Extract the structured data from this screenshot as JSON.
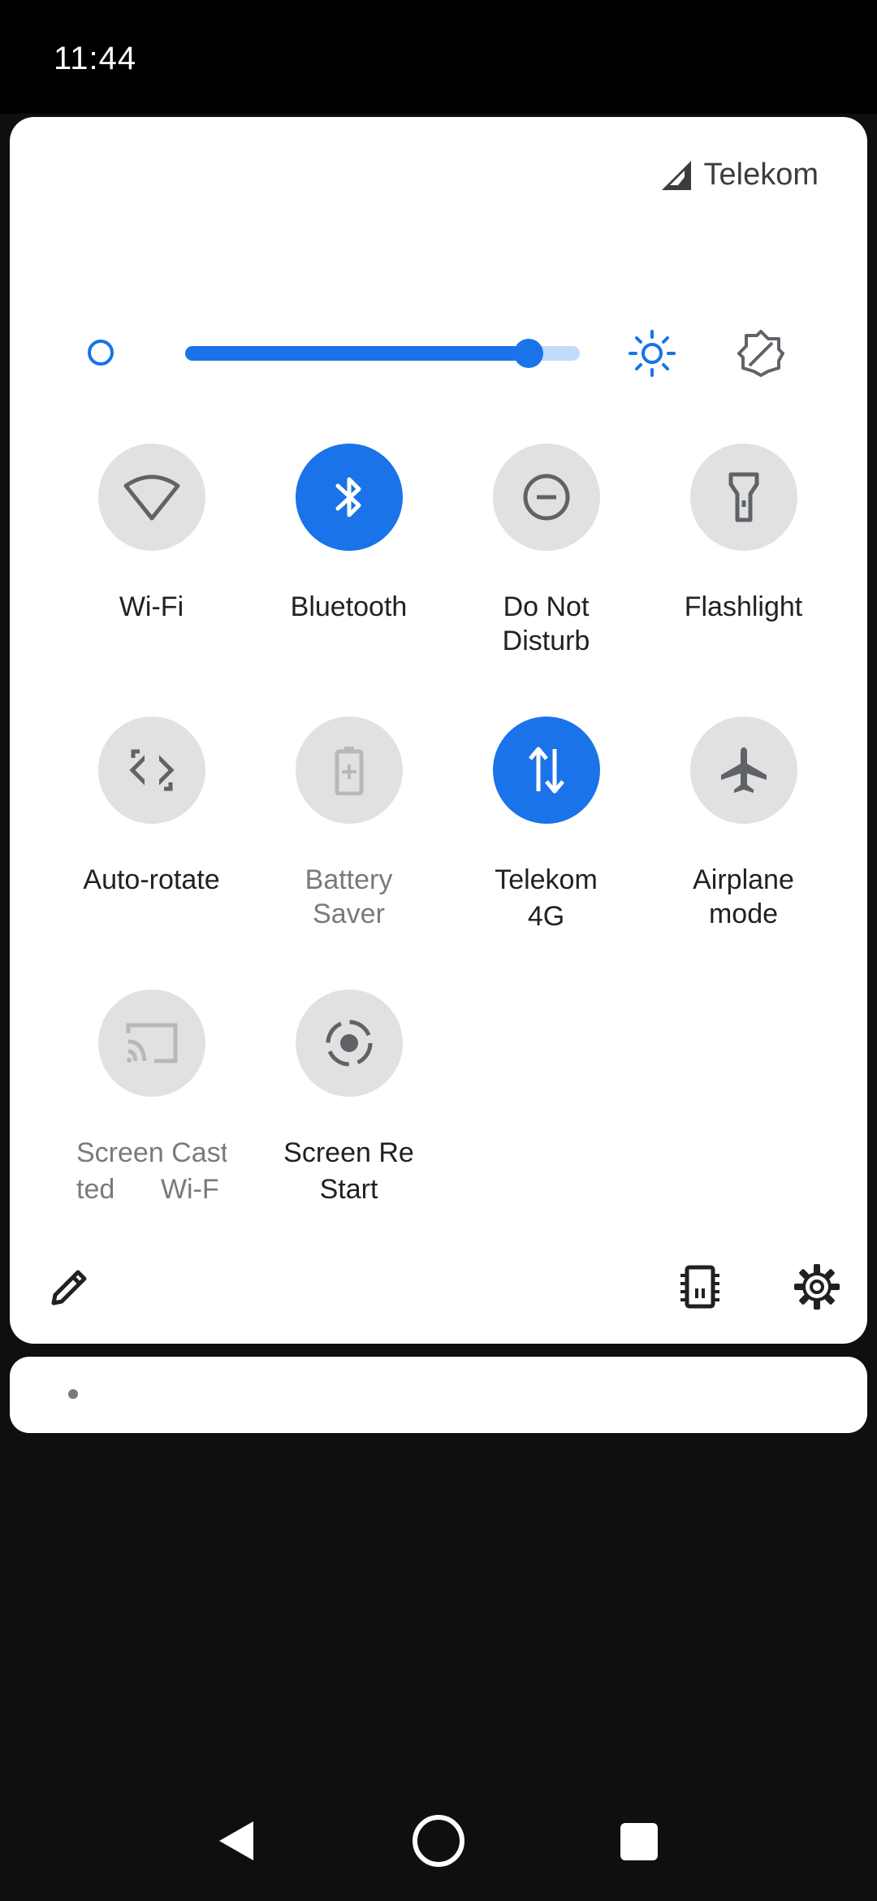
{
  "status_bar": {
    "time": "11:44"
  },
  "carrier": {
    "name": "Telekom"
  },
  "brightness": {
    "level": 0.87
  },
  "tiles": [
    {
      "label": "Wi-Fi",
      "sublabel": "",
      "icon": "wifi-icon",
      "state": "off"
    },
    {
      "label": "Bluetooth",
      "sublabel": "",
      "icon": "bluetooth-icon",
      "state": "on"
    },
    {
      "label": "Do Not\nDisturb",
      "sublabel": "",
      "icon": "do-not-disturb-icon",
      "state": "off"
    },
    {
      "label": "Flashlight",
      "sublabel": "",
      "icon": "flashlight-icon",
      "state": "off"
    },
    {
      "label": "Auto-rotate",
      "sublabel": "",
      "icon": "auto-rotate-icon",
      "state": "off"
    },
    {
      "label": "Battery\nSaver",
      "sublabel": "",
      "icon": "battery-saver-icon",
      "state": "disabled"
    },
    {
      "label": "Telekom",
      "sublabel": "4G",
      "icon": "mobile-data-icon",
      "state": "on"
    },
    {
      "label": "Airplane\nmode",
      "sublabel": "",
      "icon": "airplane-icon",
      "state": "off"
    },
    {
      "label": "Screen Cast",
      "sublabel": "ted      Wi-F",
      "icon": "cast-icon",
      "state": "disabled"
    },
    {
      "label": "Screen Re",
      "sublabel": "Start",
      "icon": "screen-record-icon",
      "state": "off"
    }
  ],
  "colors": {
    "accent": "#1a73e8",
    "tile_off": "#e1e1e1",
    "panel": "#ffffff",
    "background": "#0f0f12"
  }
}
